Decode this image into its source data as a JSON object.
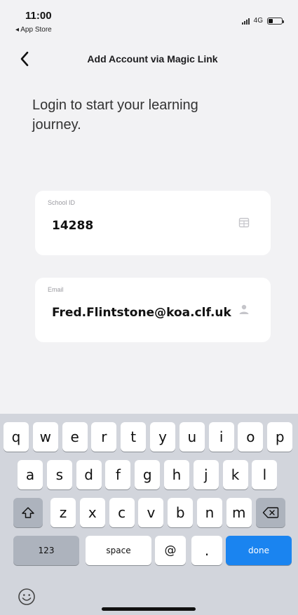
{
  "status_bar": {
    "time": "11:00",
    "back_app": "◂ App Store",
    "network": "4G",
    "battery_level": 0.35
  },
  "nav": {
    "title": "Add Account via Magic Link",
    "back_icon": "chevron-left-icon"
  },
  "headline": "Login to start your learning journey.",
  "school_id": {
    "label": "School ID",
    "value": "14288",
    "icon": "calendar-icon"
  },
  "email": {
    "label": "Email",
    "value": "Fred.Flintstone@koa.clf.uk",
    "icon": "person-icon"
  },
  "keyboard": {
    "row1": [
      "q",
      "w",
      "e",
      "r",
      "t",
      "y",
      "u",
      "i",
      "o",
      "p"
    ],
    "row2": [
      "a",
      "s",
      "d",
      "f",
      "g",
      "h",
      "j",
      "k",
      "l"
    ],
    "row3": [
      "z",
      "x",
      "c",
      "v",
      "b",
      "n",
      "m"
    ],
    "numbers_label": "123",
    "space_label": "space",
    "at_label": "@",
    "dot_label": ".",
    "done_label": "done",
    "accent_color": "#1a84f0"
  }
}
